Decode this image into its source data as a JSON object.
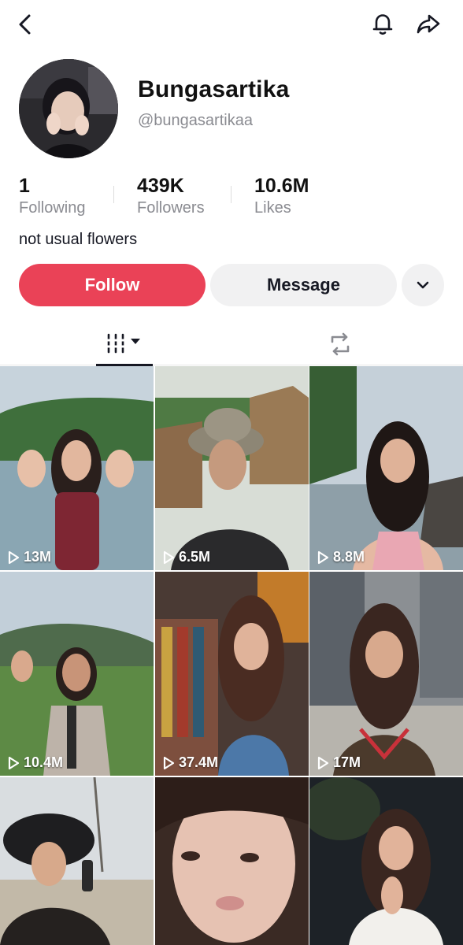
{
  "profile": {
    "display_name": "Bungasartika",
    "handle": "@bungasartikaa",
    "bio": "not usual flowers"
  },
  "stats": {
    "following": {
      "value": "1",
      "label": "Following"
    },
    "followers": {
      "value": "439K",
      "label": "Followers"
    },
    "likes": {
      "value": "10.6M",
      "label": "Likes"
    }
  },
  "actions": {
    "follow_label": "Follow",
    "message_label": "Message"
  },
  "icons": {
    "back": "back-arrow-icon",
    "notifications": "bell-icon",
    "share": "share-icon",
    "more": "chevron-down-icon",
    "videos_tab": "grid-icon",
    "reposts_tab": "repost-icon",
    "play": "play-icon"
  },
  "colors": {
    "follow": "#ea4257",
    "secondary_button": "#f1f1f2",
    "muted_text": "#8a8b91"
  },
  "videos": [
    {
      "views": "13M"
    },
    {
      "views": "6.5M"
    },
    {
      "views": "8.8M"
    },
    {
      "views": "10.4M"
    },
    {
      "views": "37.4M"
    },
    {
      "views": "17M"
    },
    {
      "views": ""
    },
    {
      "views": ""
    },
    {
      "views": ""
    }
  ]
}
